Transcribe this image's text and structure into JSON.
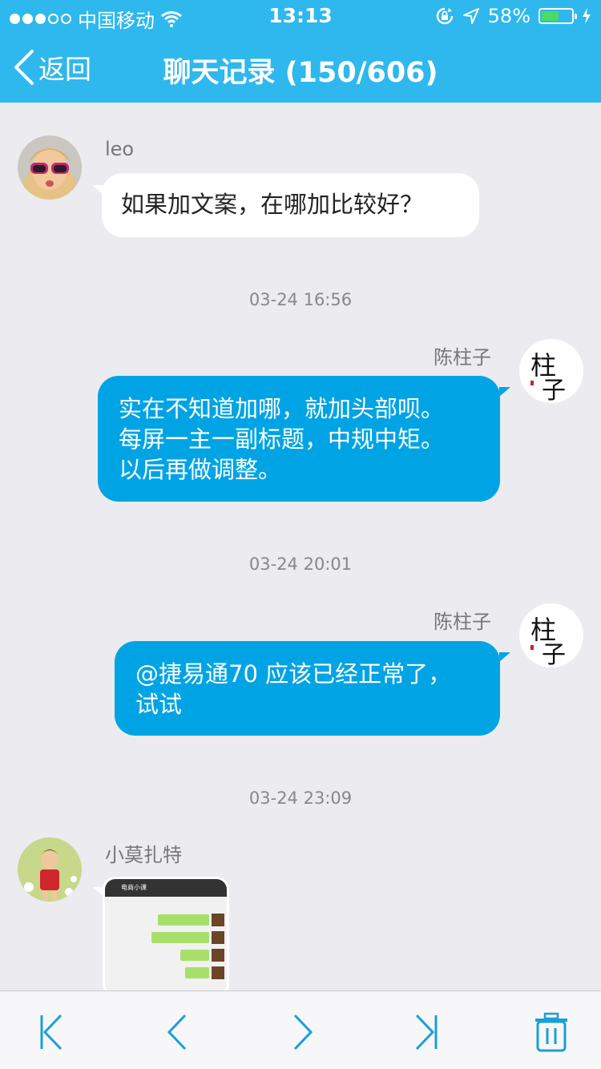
{
  "status_bar": {
    "carrier": "中国移动",
    "time": "13:13",
    "battery_text": "58%",
    "battery_level": 0.58,
    "colors": {
      "bar": "#2eb8ee",
      "battery_fill": "#4cd964"
    }
  },
  "nav": {
    "back_label": "返回",
    "title": "聊天记录",
    "page_indicator": "(150/606)"
  },
  "messages": {
    "leo_name": "leo",
    "leo_text": "如果加文案，在哪加比较好？",
    "time1": "03-24 16:56",
    "chen_name_1": "陈柱子",
    "chen_text_1_line1": "实在不知道加哪，就加头部呗。",
    "chen_text_1_line2": "每屏一主一副标题，中规中矩。",
    "chen_text_1_line3": "以后再做调整。",
    "time2": "03-24 20:01",
    "chen_name_2": "陈柱子",
    "chen_text_2_line1": "@捷易通70 应该已经正常了，",
    "chen_text_2_line2": "试试",
    "time3": "03-24 23:09",
    "mozart_name": "小莫扎特",
    "image_header_title": "电商小课"
  },
  "avatars": {
    "chen_calligraphy": "柱子"
  },
  "toolbar": {
    "icons": [
      "first-page-icon",
      "previous-page-icon",
      "next-page-icon",
      "last-page-icon",
      "trash-icon"
    ],
    "accent": "#1a9fd6"
  }
}
